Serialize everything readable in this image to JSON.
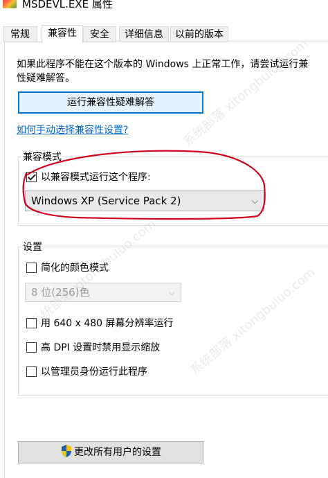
{
  "window": {
    "title": "MSDEVL.EXE 属性"
  },
  "tabs": [
    {
      "label": "常规",
      "active": false
    },
    {
      "label": "兼容性",
      "active": true
    },
    {
      "label": "安全",
      "active": false
    },
    {
      "label": "详细信息",
      "active": false
    },
    {
      "label": "以前的版本",
      "active": false
    }
  ],
  "intro": {
    "line1": "如果此程序不能在这个版本的 Windows 上正常工作，请尝试运行兼",
    "line2": "性疑难解答。"
  },
  "troubleshoot_button": "运行兼容性疑难解答",
  "manual_link": "如何手动选择兼容性设置?",
  "compat_mode": {
    "group_label": "兼容模式",
    "checkbox_label": "以兼容模式运行这个程序:",
    "checked": true,
    "selected_os": "Windows XP (Service Pack 2)"
  },
  "settings": {
    "group_label": "设置",
    "reduced_color": {
      "label": "简化的颜色模式",
      "checked": false
    },
    "color_select": "8 位(256)色",
    "res_640": {
      "label": "用 640 x 480 屏幕分辨率运行",
      "checked": false
    },
    "high_dpi": {
      "label": "高 DPI 设置时禁用显示缩放",
      "checked": false
    },
    "run_admin": {
      "label": "以管理员身份运行此程序",
      "checked": false
    }
  },
  "all_users_button": "更改所有用户的设置",
  "watermark": "系统部落 xitongbuluo.com",
  "colors": {
    "link": "#0066cc",
    "annotation": "#d0021b",
    "focus_border": "#0078d7"
  }
}
